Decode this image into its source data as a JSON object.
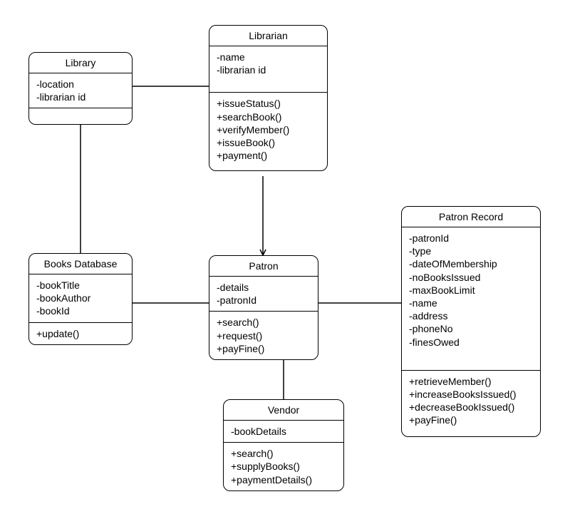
{
  "classes": {
    "library": {
      "title": "Library",
      "attributes": [
        "-location",
        "-librarian id"
      ],
      "methods": []
    },
    "librarian": {
      "title": "Librarian",
      "attributes": [
        "-name",
        "-librarian id"
      ],
      "methods": [
        "+issueStatus()",
        "+searchBook()",
        "+verifyMember()",
        "+issueBook()",
        "+payment()"
      ]
    },
    "booksDatabase": {
      "title": "Books Database",
      "attributes": [
        "-bookTitle",
        "-bookAuthor",
        "-bookId"
      ],
      "methods": [
        "+update()"
      ]
    },
    "patron": {
      "title": "Patron",
      "attributes": [
        "-details",
        "-patronId"
      ],
      "methods": [
        "+search()",
        "+request()",
        "+payFine()"
      ]
    },
    "patronRecord": {
      "title": "Patron Record",
      "attributes": [
        "-patronId",
        "-type",
        "-dateOfMembership",
        "-noBooksIssued",
        "-maxBookLimit",
        "-name",
        "-address",
        "-phoneNo",
        "-finesOwed"
      ],
      "methods": [
        "+retrieveMember()",
        "+increaseBooksIssued()",
        "+decreaseBookIssued()",
        "+payFine()"
      ]
    },
    "vendor": {
      "title": "Vendor",
      "attributes": [
        "-bookDetails"
      ],
      "methods": [
        "+search()",
        "+supplyBooks()",
        "+paymentDetails()"
      ]
    }
  },
  "relationships": [
    {
      "from": "library",
      "to": "librarian",
      "type": "association"
    },
    {
      "from": "library",
      "to": "booksDatabase",
      "type": "association"
    },
    {
      "from": "librarian",
      "to": "patron",
      "type": "directed"
    },
    {
      "from": "booksDatabase",
      "to": "patron",
      "type": "association"
    },
    {
      "from": "patron",
      "to": "patronRecord",
      "type": "association"
    },
    {
      "from": "vendor",
      "to": "patron",
      "type": "directed"
    }
  ]
}
